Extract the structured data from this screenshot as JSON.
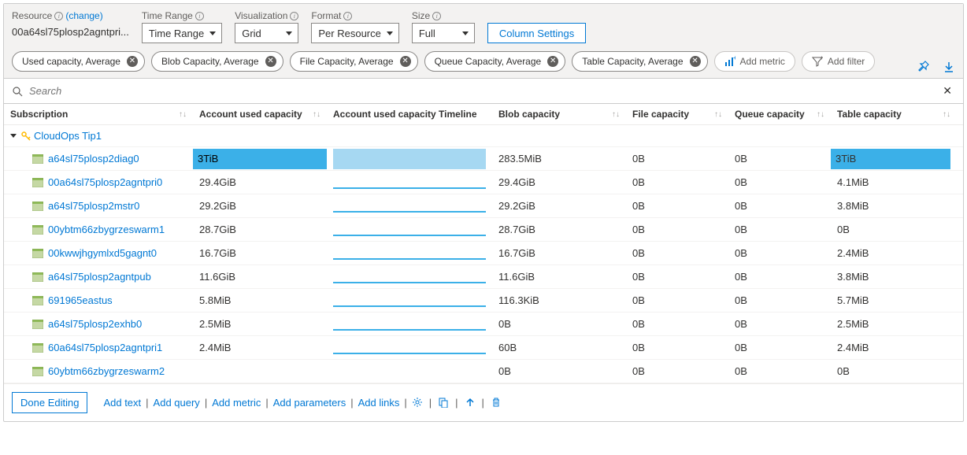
{
  "toolbar": {
    "resource_label": "Resource",
    "change_label": "(change)",
    "resource_value": "00a64sl75plosp2agntpri...",
    "time_range_label": "Time Range",
    "time_range_value": "Time Range",
    "visualization_label": "Visualization",
    "visualization_value": "Grid",
    "format_label": "Format",
    "format_value": "Per Resource",
    "size_label": "Size",
    "size_value": "Full",
    "column_settings": "Column Settings"
  },
  "metrics": [
    "Used capacity, Average",
    "Blob Capacity, Average",
    "File Capacity, Average",
    "Queue Capacity, Average",
    "Table Capacity, Average"
  ],
  "actions": {
    "add_metric": "Add metric",
    "add_filter": "Add filter"
  },
  "search": {
    "placeholder": "Search"
  },
  "columns": {
    "subscription": "Subscription",
    "used": "Account used capacity",
    "timeline": "Account used capacity Timeline",
    "blob": "Blob capacity",
    "file": "File capacity",
    "queue": "Queue capacity",
    "table": "Table capacity"
  },
  "group": {
    "name": "CloudOps Tip1"
  },
  "rows": [
    {
      "name": "a64sl75plosp2diag0",
      "used": "3TiB",
      "blob": "283.5MiB",
      "file": "0B",
      "queue": "0B",
      "table": "3TiB",
      "highlight": true
    },
    {
      "name": "00a64sl75plosp2agntpri0",
      "used": "29.4GiB",
      "blob": "29.4GiB",
      "file": "0B",
      "queue": "0B",
      "table": "4.1MiB",
      "highlight": false
    },
    {
      "name": "a64sl75plosp2mstr0",
      "used": "29.2GiB",
      "blob": "29.2GiB",
      "file": "0B",
      "queue": "0B",
      "table": "3.8MiB",
      "highlight": false
    },
    {
      "name": "00ybtm66zbygrzeswarm1",
      "used": "28.7GiB",
      "blob": "28.7GiB",
      "file": "0B",
      "queue": "0B",
      "table": "0B",
      "highlight": false
    },
    {
      "name": "00kwwjhgymlxd5gagnt0",
      "used": "16.7GiB",
      "blob": "16.7GiB",
      "file": "0B",
      "queue": "0B",
      "table": "2.4MiB",
      "highlight": false
    },
    {
      "name": "a64sl75plosp2agntpub",
      "used": "11.6GiB",
      "blob": "11.6GiB",
      "file": "0B",
      "queue": "0B",
      "table": "3.8MiB",
      "highlight": false
    },
    {
      "name": "691965eastus",
      "used": "5.8MiB",
      "blob": "116.3KiB",
      "file": "0B",
      "queue": "0B",
      "table": "5.7MiB",
      "highlight": false
    },
    {
      "name": "a64sl75plosp2exhb0",
      "used": "2.5MiB",
      "blob": "0B",
      "file": "0B",
      "queue": "0B",
      "table": "2.5MiB",
      "highlight": false
    },
    {
      "name": "60a64sl75plosp2agntpri1",
      "used": "2.4MiB",
      "blob": "60B",
      "file": "0B",
      "queue": "0B",
      "table": "2.4MiB",
      "highlight": false
    },
    {
      "name": "60ybtm66zbygrzeswarm2",
      "used": "",
      "blob": "0B",
      "file": "0B",
      "queue": "0B",
      "table": "0B",
      "highlight": false,
      "notl": true
    }
  ],
  "footer": {
    "done": "Done Editing",
    "add_text": "Add text",
    "add_query": "Add query",
    "add_metric": "Add metric",
    "add_parameters": "Add parameters",
    "add_links": "Add links"
  }
}
